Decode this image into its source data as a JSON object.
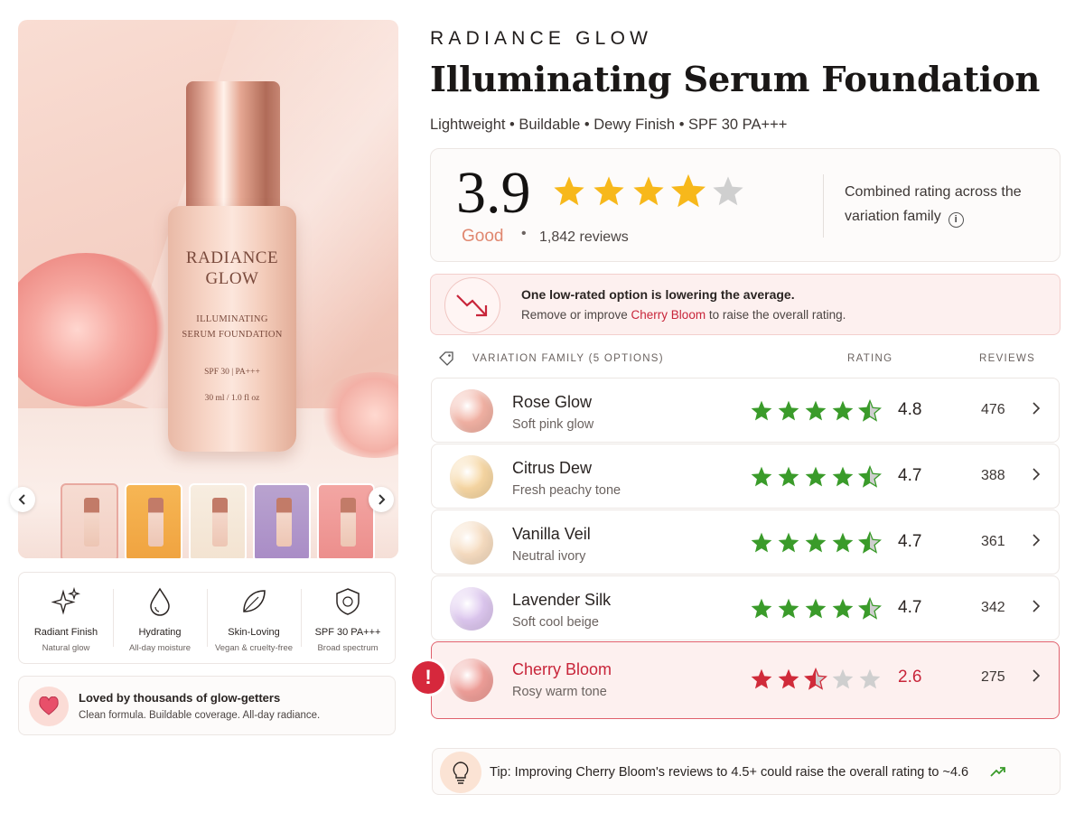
{
  "brand": "RADIANCE GLOW",
  "product": {
    "title": "Illuminating Serum Foundation",
    "subtitle": "Lightweight • Buildable • Dewy Finish • SPF 30 PA+++"
  },
  "hero": {
    "bottle_brand_line1": "RADIANCE",
    "bottle_brand_line2": "GLOW",
    "bottle_product_line1": "ILLUMINATING",
    "bottle_product_line2": "SERUM FOUNDATION",
    "bottle_spf": "SPF 30  |  PA+++",
    "bottle_volume": "30 ml / 1.0 fl oz",
    "thumbnail_count": 5,
    "selected_thumbnail": 1
  },
  "features": [
    {
      "title": "Radiant Finish",
      "sub": "Natural glow",
      "icon": "sparkle-icon"
    },
    {
      "title": "Hydrating",
      "sub": "All-day moisture",
      "icon": "droplet-icon"
    },
    {
      "title": "Skin-Loving",
      "sub": "Vegan & cruelty-free",
      "icon": "leaf-icon"
    },
    {
      "title": "SPF 30 PA+++",
      "sub": "Broad spectrum",
      "icon": "shield-icon"
    }
  ],
  "loved": {
    "title": "Loved by thousands of glow-getters",
    "sub": "Clean formula. Buildable coverage. All-day radiance."
  },
  "rating": {
    "score": "3.9",
    "stars_value": 3.9,
    "label": "Good",
    "separator": "•",
    "reviews": "1,842 reviews",
    "note": "Combined rating across the variation family",
    "info_icon": "i"
  },
  "alert": {
    "title": "One low-rated option is lowering the average.",
    "text_before": "Remove or improve ",
    "highlight": "Cherry Bloom",
    "text_after": " to raise the overall rating."
  },
  "table": {
    "header_family": "VARIATION FAMILY (5 OPTIONS)",
    "header_rating": "RATING",
    "header_reviews": "REVIEWS",
    "rows": [
      {
        "name": "Rose Glow",
        "sub": "Soft pink glow",
        "rating": "4.8",
        "stars_value": 4.5,
        "reviews": "476",
        "swatch": "#f1b1a3",
        "warning": false
      },
      {
        "name": "Citrus Dew",
        "sub": "Fresh peachy tone",
        "rating": "4.7",
        "stars_value": 4.5,
        "reviews": "388",
        "swatch": "#f6d6a2",
        "warning": false
      },
      {
        "name": "Vanilla Veil",
        "sub": "Neutral ivory",
        "rating": "4.7",
        "stars_value": 4.5,
        "reviews": "361",
        "swatch": "#f6dcc0",
        "warning": false
      },
      {
        "name": "Lavender Silk",
        "sub": "Soft cool beige",
        "rating": "4.7",
        "stars_value": 4.5,
        "reviews": "342",
        "swatch": "#dcc6ee",
        "warning": false
      },
      {
        "name": "Cherry Bloom",
        "sub": "Rosy warm tone",
        "rating": "2.6",
        "stars_value": 2.5,
        "reviews": "275",
        "swatch": "#ee9e98",
        "warning": true
      }
    ],
    "warning_symbol": "!"
  },
  "tip": {
    "text": "Tip: Improving Cherry Bloom's reviews to 4.5+ could raise the overall rating to ~4.6"
  },
  "colors": {
    "star_gold": "#f7b81b",
    "star_green": "#3a9b2a",
    "star_red": "#d02b3a",
    "star_empty": "#cfcfcf",
    "good_label": "#e0876f",
    "warning_red": "#c8253a"
  }
}
